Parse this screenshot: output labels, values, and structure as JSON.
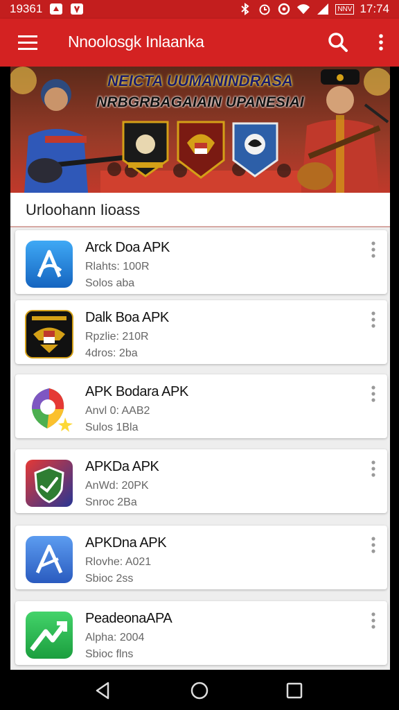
{
  "status_bar": {
    "time_left": "19361",
    "time_right": "17:74",
    "battery_label": "NNV"
  },
  "app_bar": {
    "title": "Nnoolosgk Inlaanka"
  },
  "banner": {
    "line1": "NEICTA UUMANINDRASA",
    "line2": "NRBGRBAGAIAIN UPANESIAI"
  },
  "section": {
    "title": "Urloohann Iioass"
  },
  "apps": [
    {
      "name": "Arck Doa APK",
      "meta": "Rlahts: 100R",
      "size": "Solos aba",
      "icon": "blue-a-icon"
    },
    {
      "name": "Dalk Boa APK",
      "meta": "Rpzlie: 210R",
      "size": "4dros: 2ba",
      "icon": "garuda-emblem-icon"
    },
    {
      "name": "APK Bodara APK",
      "meta": "Anvl 0: AAB2",
      "size": "Sulos 1Bla",
      "icon": "colorful-pin-icon"
    },
    {
      "name": "APKDa APK",
      "meta": "AnWd: 20PK",
      "size": "Snroc 2Ba",
      "icon": "shield-check-icon"
    },
    {
      "name": "APKDna APK",
      "meta": "Rlovhe: A021",
      "size": "Sbioc 2ss",
      "icon": "blue-a-icon-2"
    },
    {
      "name": "PeadeonaAPA",
      "meta": "Alpha: 2004",
      "size": "Sbioc flns",
      "icon": "green-arrow-icon"
    }
  ],
  "colors": {
    "status_bar": "#c31e1e",
    "app_bar": "#d42222",
    "background": "#eeeeee",
    "accent_divider": "#d7a8a3"
  }
}
